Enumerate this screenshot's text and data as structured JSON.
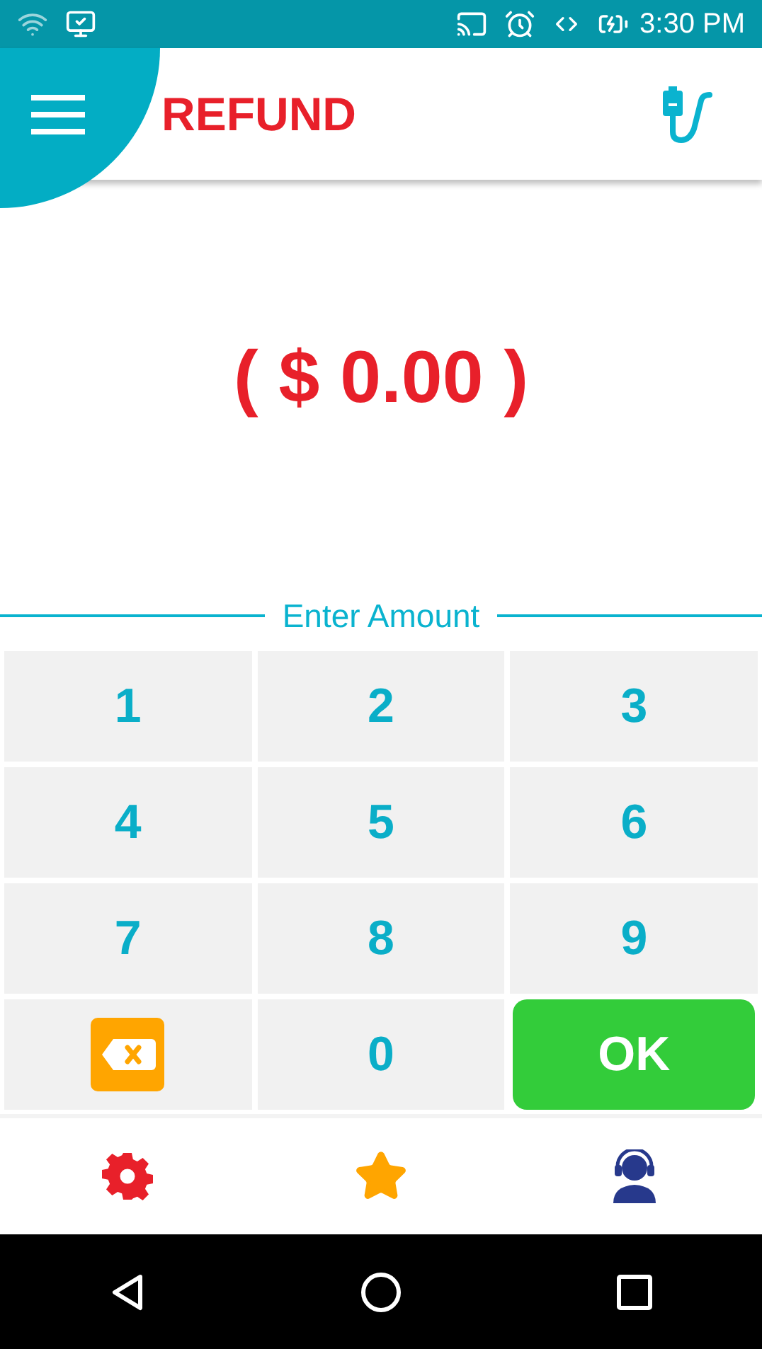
{
  "status_bar": {
    "time": "3:30 PM"
  },
  "header": {
    "title": "REFUND"
  },
  "amount": {
    "value": "( $ 0.00 )"
  },
  "divider": {
    "label": "Enter Amount"
  },
  "keypad": [
    {
      "kind": "digit",
      "label": "1"
    },
    {
      "kind": "digit",
      "label": "2"
    },
    {
      "kind": "digit",
      "label": "3"
    },
    {
      "kind": "digit",
      "label": "4"
    },
    {
      "kind": "digit",
      "label": "5"
    },
    {
      "kind": "digit",
      "label": "6"
    },
    {
      "kind": "digit",
      "label": "7"
    },
    {
      "kind": "digit",
      "label": "8"
    },
    {
      "kind": "digit",
      "label": "9"
    },
    {
      "kind": "backspace"
    },
    {
      "kind": "digit",
      "label": "0"
    },
    {
      "kind": "ok",
      "label": "OK"
    }
  ]
}
